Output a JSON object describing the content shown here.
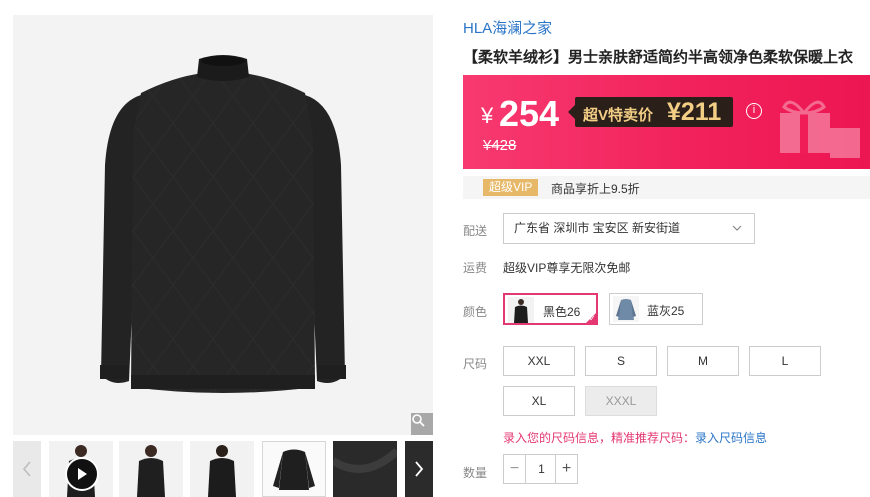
{
  "gallery": {
    "main_image": "black-mock-neck-sweater",
    "zoom_icon": "magnifier-icon",
    "thumbnails": [
      "model-front-video",
      "model-front",
      "model-back",
      "sweater-flat",
      "sweater-fabric-closeup"
    ],
    "prev_icon": "chevron-left-icon",
    "next_icon": "chevron-right-icon"
  },
  "product": {
    "brand": "HLA海澜之家",
    "title": "【柔软羊绒衫】男士亲肤舒适简约半高领净色柔软保暖上衣"
  },
  "price": {
    "currency": "¥",
    "current": "254",
    "vip_label": "超V特卖价",
    "vip_price": "¥211",
    "original": "¥428",
    "info_icon": "info-icon"
  },
  "vip_bar": {
    "badge": "超级VIP",
    "text": "商品享折上9.5折"
  },
  "delivery": {
    "label": "配送",
    "address": "广东省 深圳市 宝安区 新安街道"
  },
  "shipping": {
    "label": "运费",
    "value": "超级VIP尊享无限次免邮"
  },
  "color": {
    "label": "颜色",
    "options": [
      {
        "label": "黑色26",
        "selected": true,
        "swatch": "#1d1d1d"
      },
      {
        "label": "蓝灰25",
        "selected": false,
        "swatch": "#6f8aa6"
      }
    ]
  },
  "size": {
    "label": "尺码",
    "options": [
      {
        "label": "XXL",
        "disabled": false
      },
      {
        "label": "S",
        "disabled": false
      },
      {
        "label": "M",
        "disabled": false
      },
      {
        "label": "L",
        "disabled": false
      },
      {
        "label": "XL",
        "disabled": false
      },
      {
        "label": "XXXL",
        "disabled": true
      }
    ],
    "hint": "录入您的尺码信息，精准推荐尺码：",
    "hint_link": "录入尺码信息"
  },
  "quantity": {
    "label": "数量",
    "value": "1",
    "minus": "−",
    "plus": "+"
  },
  "colors": {
    "accent": "#e43873",
    "brand_link": "#2a75c7",
    "vip_gold": "#f3cf86"
  }
}
